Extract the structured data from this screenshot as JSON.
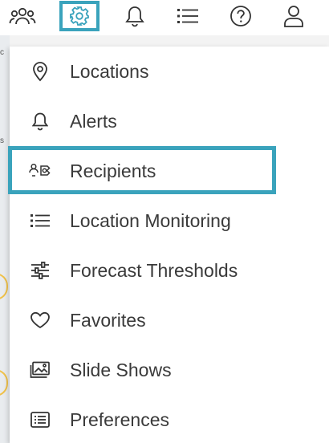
{
  "toolbar": {
    "items": [
      {
        "icon": "people-icon"
      },
      {
        "icon": "gear-icon",
        "active": true
      },
      {
        "icon": "bell-icon"
      },
      {
        "icon": "list-icon"
      },
      {
        "icon": "help-icon"
      },
      {
        "icon": "user-icon"
      }
    ]
  },
  "menu": {
    "items": [
      {
        "label": "Locations",
        "icon": "location-pin-icon"
      },
      {
        "label": "Alerts",
        "icon": "bell-icon"
      },
      {
        "label": "Recipients",
        "icon": "recipients-icon",
        "highlighted": true
      },
      {
        "label": "Location Monitoring",
        "icon": "list-icon"
      },
      {
        "label": "Forecast Thresholds",
        "icon": "sliders-icon"
      },
      {
        "label": "Favorites",
        "icon": "heart-icon"
      },
      {
        "label": "Slide Shows",
        "icon": "image-icon"
      },
      {
        "label": "Preferences",
        "icon": "preferences-icon"
      }
    ]
  },
  "colors": {
    "accent": "#3aa3bc",
    "text": "#3a3a3a",
    "icon": "#333333"
  }
}
